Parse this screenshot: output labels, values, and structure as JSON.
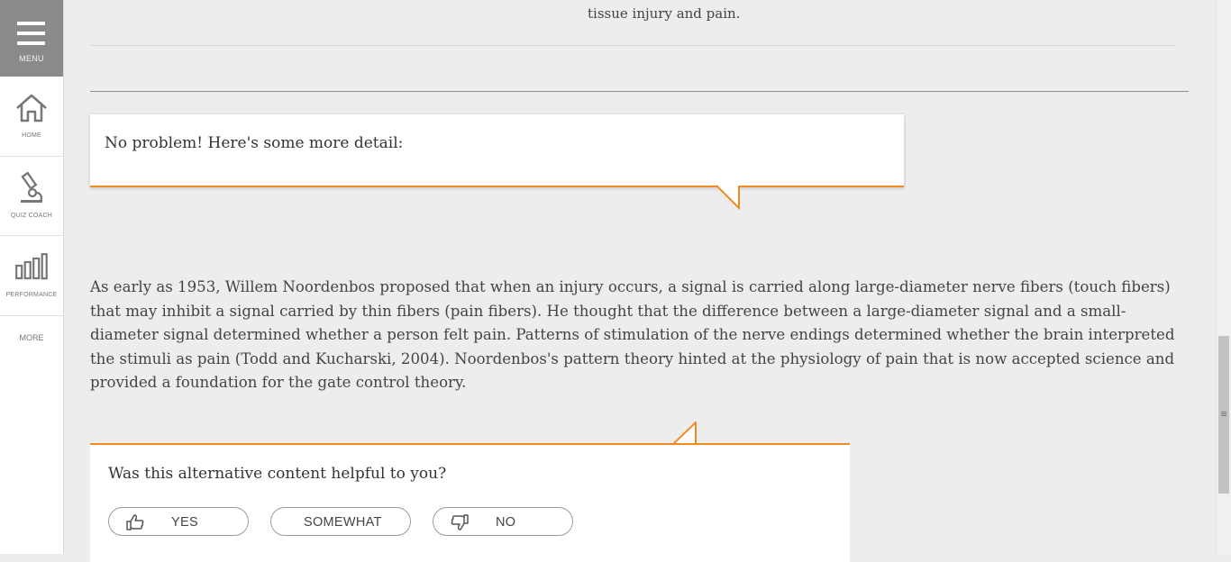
{
  "sidebar": {
    "menu_label": "MENU",
    "items": [
      {
        "label": "HOME",
        "icon": "home-icon"
      },
      {
        "label": "QUIZ COACH",
        "icon": "microscope-icon"
      },
      {
        "label": "PERFORMANCE",
        "icon": "bar-chart-icon"
      }
    ],
    "more_label": "MORE"
  },
  "content": {
    "top_text": "tissue injury and pain.",
    "bubble_text": "No problem! Here's some more detail:",
    "paragraph": "As early as 1953, Willem Noordenbos proposed that when an injury occurs, a signal is carried along large-diameter nerve fibers (touch fibers) that may inhibit a signal carried by thin fibers (pain fibers). He thought that the difference between a large-diameter signal and a small-diameter signal determined whether a person felt pain. Patterns of stimulation of the nerve endings determined whether the brain interpreted the stimuli as pain (Todd and Kucharski, 2004). Noordenbos's pattern theory hinted at the physiology of pain that is now accepted science and provided a foundation for the gate control theory."
  },
  "feedback": {
    "question": "Was this alternative content helpful to you?",
    "yes_label": "YES",
    "somewhat_label": "SOMEWHAT",
    "no_label": "NO"
  },
  "colors": {
    "accent": "#f18a21",
    "menu_bg": "#8a8a8a",
    "page_bg": "#ededed"
  }
}
